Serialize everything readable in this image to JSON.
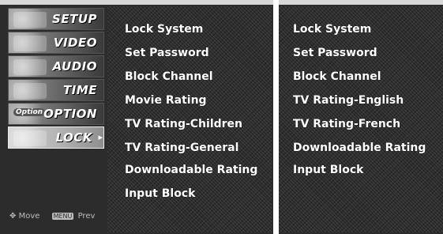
{
  "sidebar": {
    "items": [
      {
        "label": "SETUP",
        "selected": false
      },
      {
        "label": "VIDEO",
        "selected": false
      },
      {
        "label": "AUDIO",
        "selected": false
      },
      {
        "label": "TIME",
        "selected": false
      },
      {
        "label": "OPTION",
        "selected": false,
        "badge": "Option"
      },
      {
        "label": "LOCK",
        "selected": true
      }
    ],
    "arrow": "▸"
  },
  "footer": {
    "move_icon": "✥",
    "move_label": "Move",
    "menu_key": "MENU",
    "prev_label": "Prev"
  },
  "menu_main": {
    "items": [
      "Lock System",
      "Set Password",
      "Block Channel",
      "Movie Rating",
      "TV Rating-Children",
      "TV Rating-General",
      "Downloadable Rating",
      "Input Block"
    ]
  },
  "menu_alt": {
    "items": [
      "Lock System",
      "Set Password",
      "Block Channel",
      "TV Rating-English",
      "TV Rating-French",
      "Downloadable Rating",
      "Input Block"
    ]
  }
}
